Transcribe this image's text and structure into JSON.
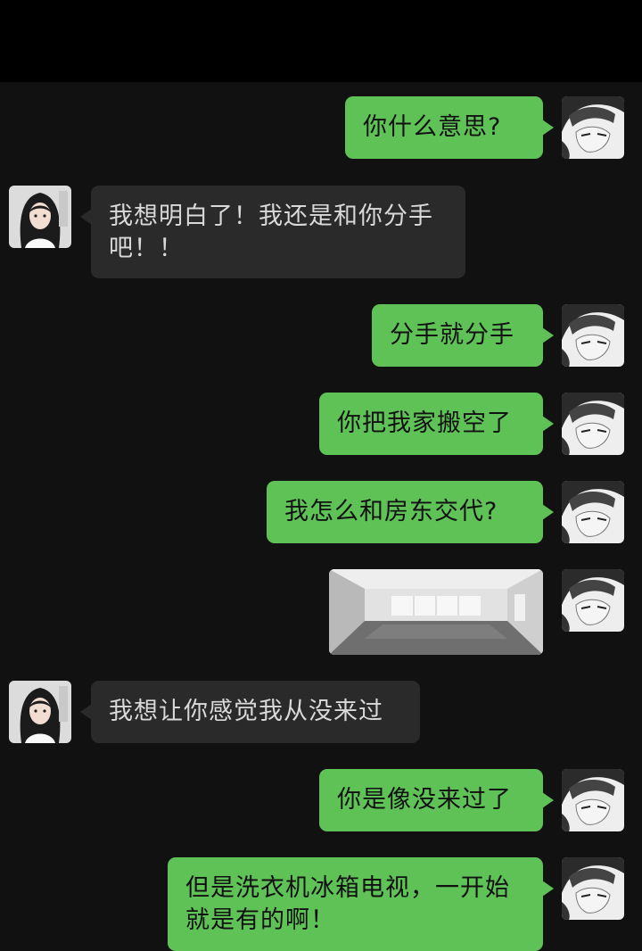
{
  "chat": {
    "messages": [
      {
        "side": "sent",
        "text": "你什么意思?"
      },
      {
        "side": "received",
        "text": "我想明白了！我还是和你分手\n吧！！"
      },
      {
        "side": "sent",
        "text": "分手就分手"
      },
      {
        "side": "sent",
        "text": "你把我家搬空了"
      },
      {
        "side": "sent",
        "text": "我怎么和房东交代?"
      },
      {
        "side": "sent",
        "type": "image",
        "image": "empty-apartment-room"
      },
      {
        "side": "received",
        "text": "我想让你感觉我从没来过"
      },
      {
        "side": "sent",
        "text": "你是像没来过了"
      },
      {
        "side": "sent",
        "text": "但是洗衣机冰箱电视，一开始\n就是有的啊！"
      }
    ]
  },
  "colors": {
    "background": "#111111",
    "top_bar": "#000000",
    "sent_bubble": "#5fc257",
    "received_bubble": "#2a2a2a",
    "received_text": "#d9d9d9"
  },
  "icons": {
    "self_avatar": "sketch-man-avatar",
    "contact_avatar": "girl-photo-avatar"
  }
}
